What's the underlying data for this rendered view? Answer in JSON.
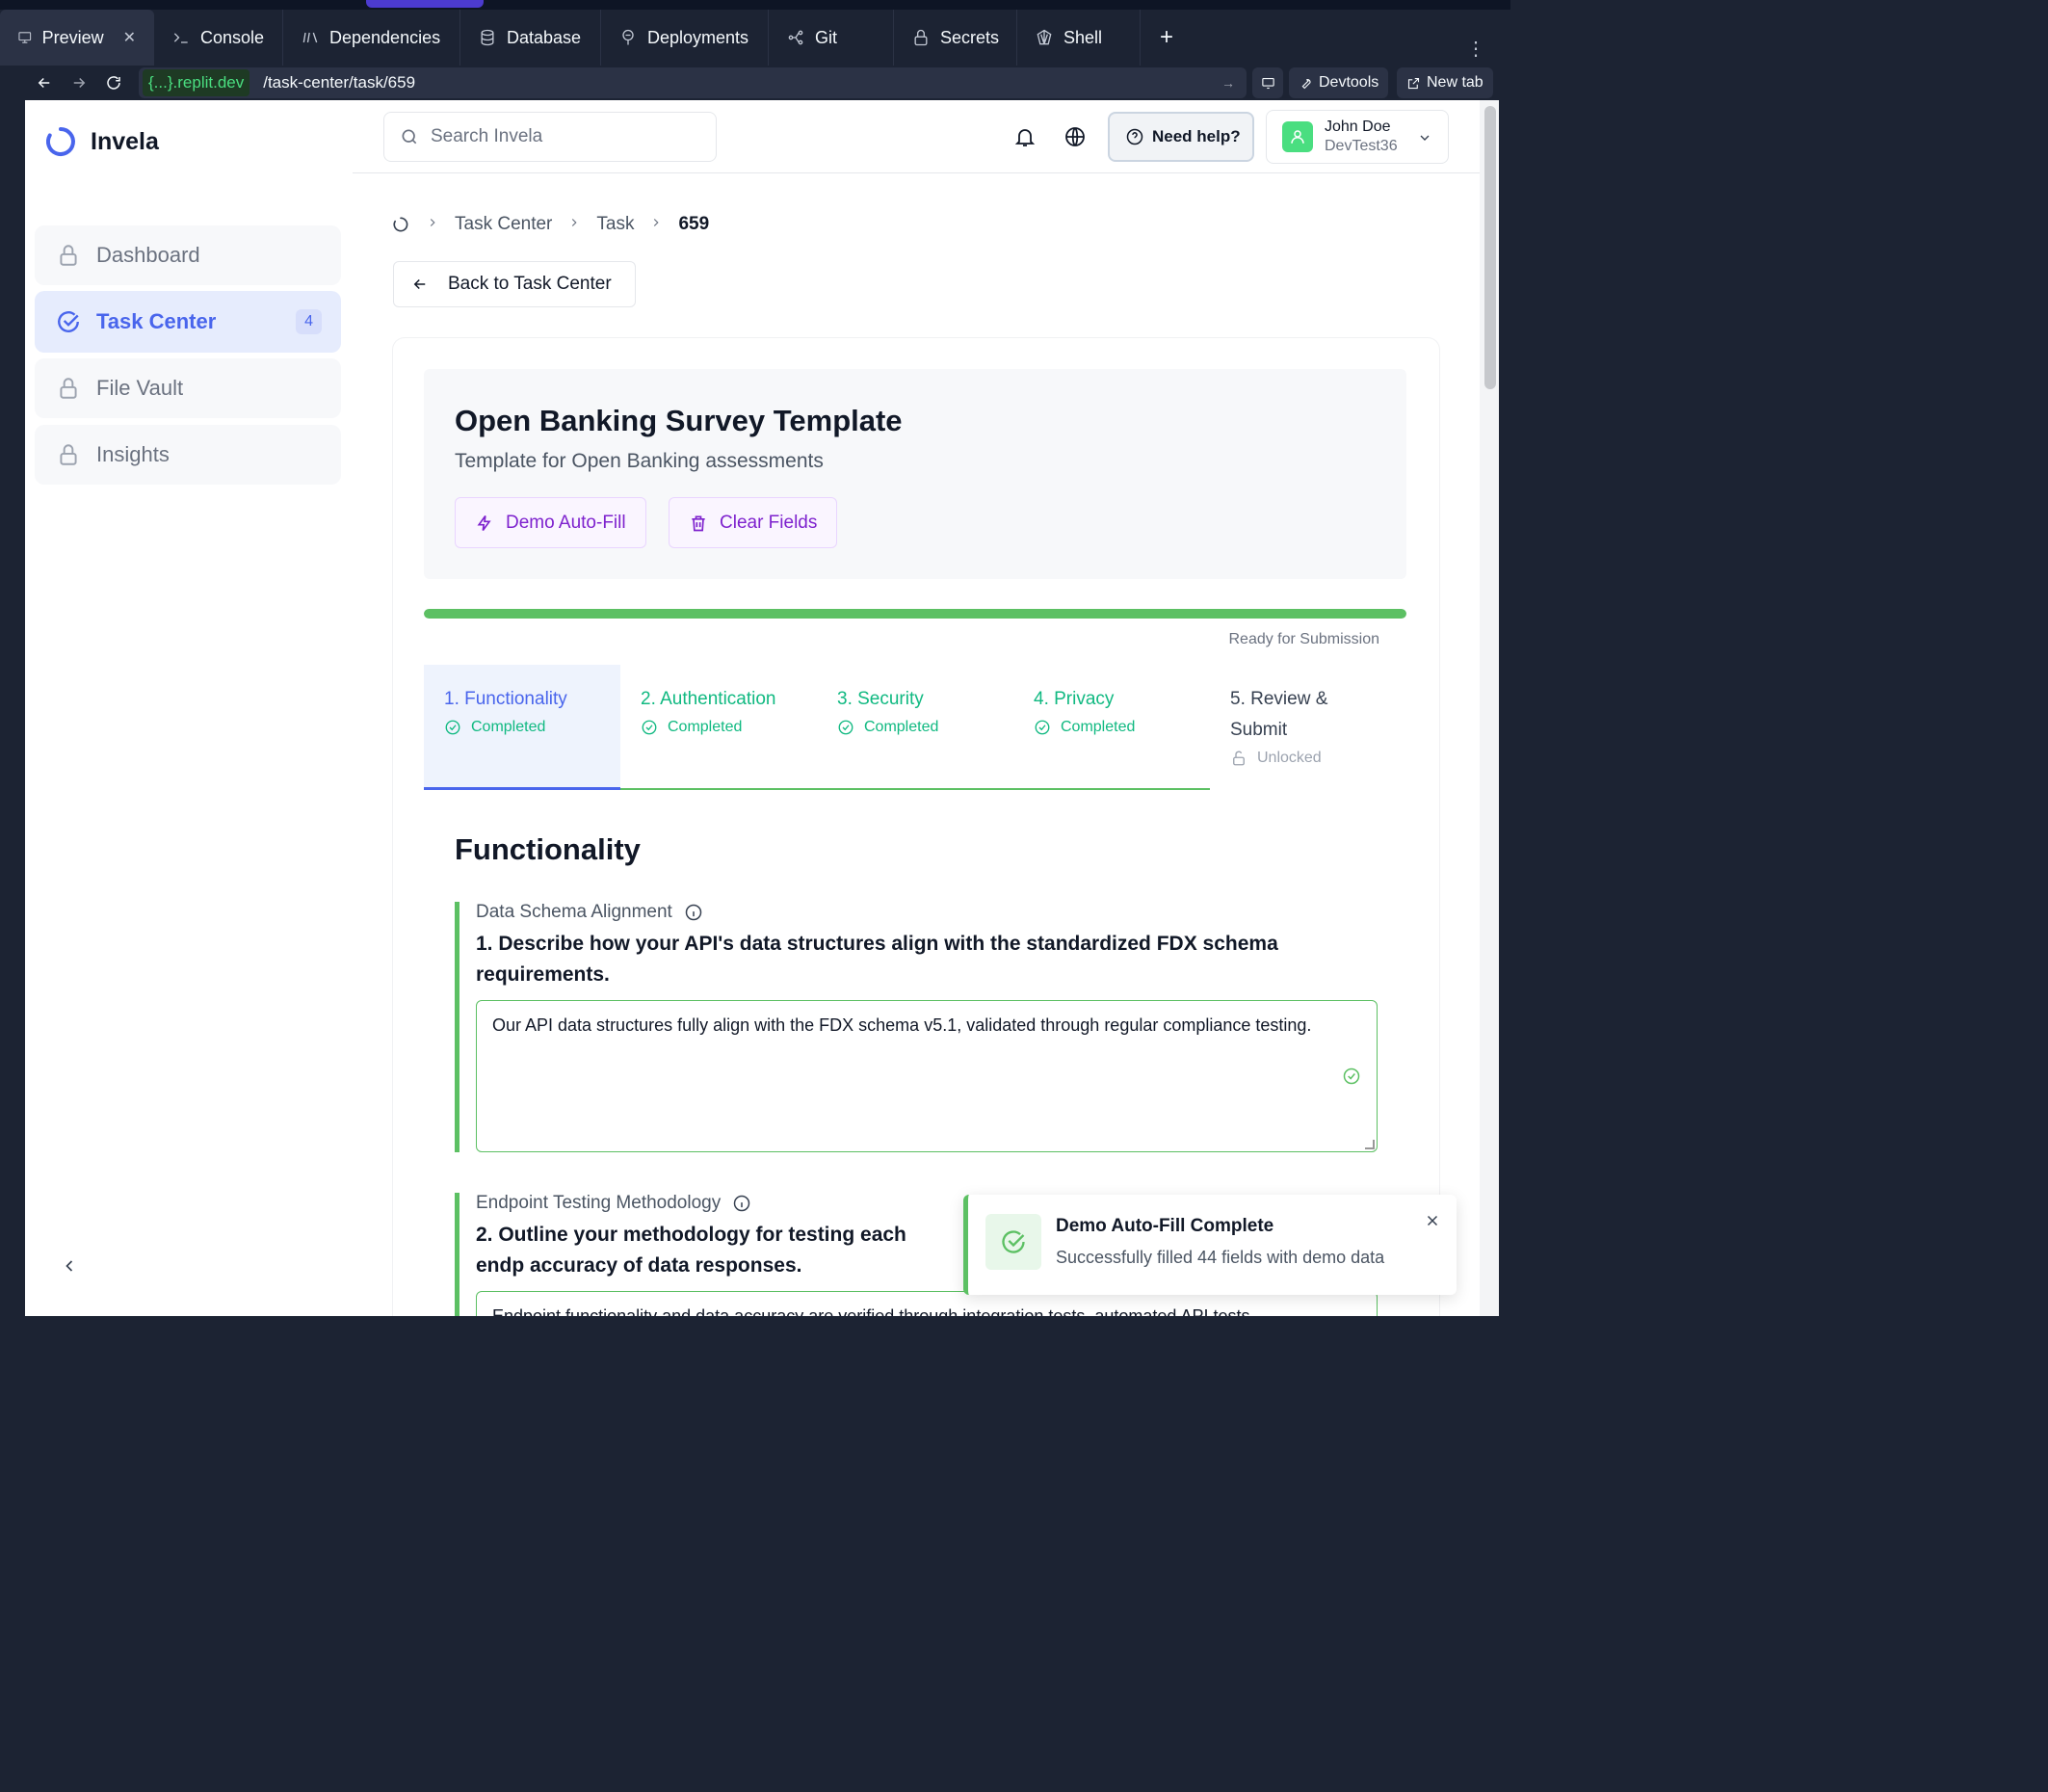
{
  "replit": {
    "tabs": [
      {
        "label": "Preview",
        "icon": "monitor-icon",
        "active": true
      },
      {
        "label": "Console",
        "icon": "terminal-icon"
      },
      {
        "label": "Dependencies",
        "icon": "packages-icon"
      },
      {
        "label": "Database",
        "icon": "database-icon"
      },
      {
        "label": "Deployments",
        "icon": "deploy-icon"
      },
      {
        "label": "Git",
        "icon": "git-icon"
      },
      {
        "label": "Secrets",
        "icon": "lock-icon"
      },
      {
        "label": "Shell",
        "icon": "shell-icon"
      }
    ],
    "url_host": "{...}.replit.dev",
    "url_path": "/task-center/task/659",
    "devtools_label": "Devtools",
    "newtab_label": "New tab"
  },
  "sidebar": {
    "brand": "Invela",
    "items": [
      {
        "label": "Dashboard",
        "icon": "lock-icon",
        "active": false
      },
      {
        "label": "Task Center",
        "icon": "check-circle-icon",
        "active": true,
        "badge": "4"
      },
      {
        "label": "File Vault",
        "icon": "lock-icon",
        "active": false
      },
      {
        "label": "Insights",
        "icon": "lock-icon",
        "active": false
      }
    ]
  },
  "header": {
    "search_placeholder": "Search Invela",
    "help_label": "Need help?",
    "user_name": "John Doe",
    "user_company": "DevTest36"
  },
  "breadcrumb": {
    "items": [
      "Task Center",
      "Task"
    ],
    "current": "659"
  },
  "back_label": "Back to Task Center",
  "form": {
    "title": "Open Banking Survey Template",
    "subtitle": "Template for Open Banking assessments",
    "autofill_label": "Demo Auto-Fill",
    "clear_label": "Clear Fields",
    "progress_percent": 100,
    "progress_label": "Ready for Submission",
    "steps": [
      {
        "title": "1. Functionality",
        "status": "Completed"
      },
      {
        "title": "2. Authentication",
        "status": "Completed"
      },
      {
        "title": "3. Security",
        "status": "Completed"
      },
      {
        "title": "4. Privacy",
        "status": "Completed"
      },
      {
        "title": "5. Review & Submit",
        "status": "Unlocked"
      }
    ],
    "section_title": "Functionality",
    "questions": [
      {
        "label": "Data Schema Alignment",
        "text": "1. Describe how your API's data structures align with the standardized FDX schema requirements.",
        "answer": "Our API data structures fully align with the FDX schema v5.1, validated through regular compliance testing."
      },
      {
        "label": "Endpoint Testing Methodology",
        "text": "2. Outline your methodology for testing each endp accuracy of data responses.",
        "answer": "Endpoint functionality and data accuracy are verified through integration tests, automated API tests"
      }
    ]
  },
  "toast": {
    "title": "Demo Auto-Fill Complete",
    "message": "Successfully filled 44 fields with demo data"
  },
  "colors": {
    "accent": "#4965ec",
    "success": "#5cc063",
    "purple": "#7e22ce"
  }
}
